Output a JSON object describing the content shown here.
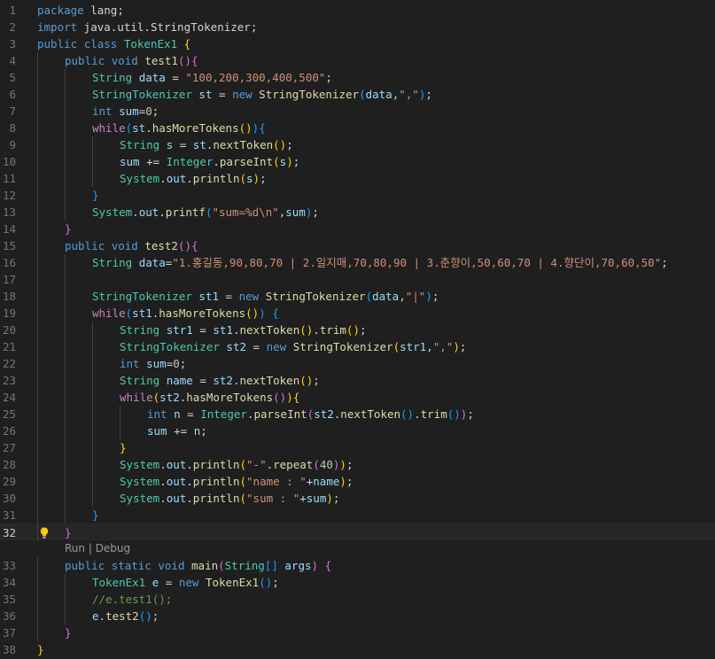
{
  "editor": {
    "colors": {
      "background": "#1f1f1f",
      "activeLine": "#262626",
      "lineNumber": "#6e7681",
      "lightbulb": "#ffcc00"
    },
    "codelens": {
      "run": "Run",
      "separator": " | ",
      "debug": "Debug"
    },
    "lines": [
      {
        "n": "1",
        "tokens": [
          [
            "kw",
            "package"
          ],
          [
            "pl",
            " lang;"
          ]
        ]
      },
      {
        "n": "2",
        "tokens": [
          [
            "kw",
            "import"
          ],
          [
            "pl",
            " java.util.StringTokenizer;"
          ]
        ]
      },
      {
        "n": "3",
        "tokens": [
          [
            "kw",
            "public"
          ],
          [
            "pl",
            " "
          ],
          [
            "kw",
            "class"
          ],
          [
            "pl",
            " "
          ],
          [
            "ty",
            "TokenEx1"
          ],
          [
            "pl",
            " "
          ],
          [
            "p1",
            "{"
          ]
        ]
      },
      {
        "n": "4",
        "indent": 1,
        "tokens": [
          [
            "kw",
            "public"
          ],
          [
            "pl",
            " "
          ],
          [
            "kw",
            "void"
          ],
          [
            "pl",
            " "
          ],
          [
            "fn",
            "test1"
          ],
          [
            "p2",
            "()"
          ],
          [
            "p2",
            "{"
          ]
        ]
      },
      {
        "n": "5",
        "indent": 2,
        "tokens": [
          [
            "ty",
            "String"
          ],
          [
            "pl",
            " "
          ],
          [
            "var",
            "data"
          ],
          [
            "pl",
            " = "
          ],
          [
            "str",
            "\"100,200,300,400,500\""
          ],
          [
            "pl",
            ";"
          ]
        ]
      },
      {
        "n": "6",
        "indent": 2,
        "tokens": [
          [
            "ty",
            "StringTokenizer"
          ],
          [
            "pl",
            " "
          ],
          [
            "var",
            "st"
          ],
          [
            "pl",
            " = "
          ],
          [
            "kw",
            "new"
          ],
          [
            "pl",
            " "
          ],
          [
            "fn",
            "StringTokenizer"
          ],
          [
            "p3",
            "("
          ],
          [
            "var",
            "data"
          ],
          [
            "pl",
            ","
          ],
          [
            "str",
            "\",\""
          ],
          [
            "p3",
            ")"
          ],
          [
            "pl",
            ";"
          ]
        ]
      },
      {
        "n": "7",
        "indent": 2,
        "tokens": [
          [
            "kw",
            "int"
          ],
          [
            "pl",
            " "
          ],
          [
            "var",
            "sum"
          ],
          [
            "pl",
            "="
          ],
          [
            "num",
            "0"
          ],
          [
            "pl",
            ";"
          ]
        ]
      },
      {
        "n": "8",
        "indent": 2,
        "tokens": [
          [
            "ctl",
            "while"
          ],
          [
            "p3",
            "("
          ],
          [
            "var",
            "st"
          ],
          [
            "pl",
            "."
          ],
          [
            "fn",
            "hasMoreTokens"
          ],
          [
            "p1",
            "()"
          ],
          [
            "p3",
            ")"
          ],
          [
            "p3",
            "{"
          ]
        ]
      },
      {
        "n": "9",
        "indent": 3,
        "tokens": [
          [
            "ty",
            "String"
          ],
          [
            "pl",
            " "
          ],
          [
            "var",
            "s"
          ],
          [
            "pl",
            " = "
          ],
          [
            "var",
            "st"
          ],
          [
            "pl",
            "."
          ],
          [
            "fn",
            "nextToken"
          ],
          [
            "p1",
            "()"
          ],
          [
            "pl",
            ";"
          ]
        ]
      },
      {
        "n": "10",
        "indent": 3,
        "tokens": [
          [
            "var",
            "sum"
          ],
          [
            "pl",
            " += "
          ],
          [
            "ty",
            "Integer"
          ],
          [
            "pl",
            "."
          ],
          [
            "fn",
            "parseInt"
          ],
          [
            "p1",
            "("
          ],
          [
            "var",
            "s"
          ],
          [
            "p1",
            ")"
          ],
          [
            "pl",
            ";"
          ]
        ]
      },
      {
        "n": "11",
        "indent": 3,
        "tokens": [
          [
            "ty",
            "System"
          ],
          [
            "pl",
            "."
          ],
          [
            "var",
            "out"
          ],
          [
            "pl",
            "."
          ],
          [
            "fn",
            "println"
          ],
          [
            "p1",
            "("
          ],
          [
            "var",
            "s"
          ],
          [
            "p1",
            ")"
          ],
          [
            "pl",
            ";"
          ]
        ]
      },
      {
        "n": "12",
        "indent": 2,
        "tokens": [
          [
            "p3",
            "}"
          ]
        ]
      },
      {
        "n": "13",
        "indent": 2,
        "tokens": [
          [
            "ty",
            "System"
          ],
          [
            "pl",
            "."
          ],
          [
            "var",
            "out"
          ],
          [
            "pl",
            "."
          ],
          [
            "fn",
            "printf"
          ],
          [
            "p3",
            "("
          ],
          [
            "str",
            "\"sum=%d\\n\""
          ],
          [
            "pl",
            ","
          ],
          [
            "var",
            "sum"
          ],
          [
            "p3",
            ")"
          ],
          [
            "pl",
            ";"
          ]
        ]
      },
      {
        "n": "14",
        "indent": 1,
        "tokens": [
          [
            "p2",
            "}"
          ]
        ]
      },
      {
        "n": "15",
        "indent": 1,
        "tokens": [
          [
            "kw",
            "public"
          ],
          [
            "pl",
            " "
          ],
          [
            "kw",
            "void"
          ],
          [
            "pl",
            " "
          ],
          [
            "fn",
            "test2"
          ],
          [
            "p2",
            "()"
          ],
          [
            "p2",
            "{"
          ]
        ]
      },
      {
        "n": "16",
        "indent": 2,
        "tokens": [
          [
            "ty",
            "String"
          ],
          [
            "pl",
            " "
          ],
          [
            "var",
            "data"
          ],
          [
            "pl",
            "="
          ],
          [
            "str",
            "\"1.홍길동,90,80,70 | 2.일지매,70,80,90 | 3.춘향이,50,60,70 | 4.향단이,70,60,50\""
          ],
          [
            "pl",
            ";"
          ]
        ]
      },
      {
        "n": "17",
        "indent": 2,
        "tokens": []
      },
      {
        "n": "18",
        "indent": 2,
        "tokens": [
          [
            "ty",
            "StringTokenizer"
          ],
          [
            "pl",
            " "
          ],
          [
            "var",
            "st1"
          ],
          [
            "pl",
            " = "
          ],
          [
            "kw",
            "new"
          ],
          [
            "pl",
            " "
          ],
          [
            "fn",
            "StringTokenizer"
          ],
          [
            "p3",
            "("
          ],
          [
            "var",
            "data"
          ],
          [
            "pl",
            ","
          ],
          [
            "str",
            "\"|\""
          ],
          [
            "p3",
            ")"
          ],
          [
            "pl",
            ";"
          ]
        ]
      },
      {
        "n": "19",
        "indent": 2,
        "tokens": [
          [
            "ctl",
            "while"
          ],
          [
            "p3",
            "("
          ],
          [
            "var",
            "st1"
          ],
          [
            "pl",
            "."
          ],
          [
            "fn",
            "hasMoreTokens"
          ],
          [
            "p1",
            "()"
          ],
          [
            "p3",
            ")"
          ],
          [
            "pl",
            " "
          ],
          [
            "p3",
            "{"
          ]
        ]
      },
      {
        "n": "20",
        "indent": 3,
        "tokens": [
          [
            "ty",
            "String"
          ],
          [
            "pl",
            " "
          ],
          [
            "var",
            "str1"
          ],
          [
            "pl",
            " = "
          ],
          [
            "var",
            "st1"
          ],
          [
            "pl",
            "."
          ],
          [
            "fn",
            "nextToken"
          ],
          [
            "p1",
            "()"
          ],
          [
            "pl",
            "."
          ],
          [
            "fn",
            "trim"
          ],
          [
            "p1",
            "()"
          ],
          [
            "pl",
            ";"
          ]
        ]
      },
      {
        "n": "21",
        "indent": 3,
        "tokens": [
          [
            "ty",
            "StringTokenizer"
          ],
          [
            "pl",
            " "
          ],
          [
            "var",
            "st2"
          ],
          [
            "pl",
            " = "
          ],
          [
            "kw",
            "new"
          ],
          [
            "pl",
            " "
          ],
          [
            "fn",
            "StringTokenizer"
          ],
          [
            "p1",
            "("
          ],
          [
            "var",
            "str1"
          ],
          [
            "pl",
            ","
          ],
          [
            "str",
            "\",\""
          ],
          [
            "p1",
            ")"
          ],
          [
            "pl",
            ";"
          ]
        ]
      },
      {
        "n": "22",
        "indent": 3,
        "tokens": [
          [
            "kw",
            "int"
          ],
          [
            "pl",
            " "
          ],
          [
            "var",
            "sum"
          ],
          [
            "pl",
            "="
          ],
          [
            "num",
            "0"
          ],
          [
            "pl",
            ";"
          ]
        ]
      },
      {
        "n": "23",
        "indent": 3,
        "tokens": [
          [
            "ty",
            "String"
          ],
          [
            "pl",
            " "
          ],
          [
            "var",
            "name"
          ],
          [
            "pl",
            " = "
          ],
          [
            "var",
            "st2"
          ],
          [
            "pl",
            "."
          ],
          [
            "fn",
            "nextToken"
          ],
          [
            "p1",
            "()"
          ],
          [
            "pl",
            ";"
          ]
        ]
      },
      {
        "n": "24",
        "indent": 3,
        "tokens": [
          [
            "ctl",
            "while"
          ],
          [
            "p1",
            "("
          ],
          [
            "var",
            "st2"
          ],
          [
            "pl",
            "."
          ],
          [
            "fn",
            "hasMoreTokens"
          ],
          [
            "p2",
            "()"
          ],
          [
            "p1",
            ")"
          ],
          [
            "p1",
            "{"
          ]
        ]
      },
      {
        "n": "25",
        "indent": 4,
        "tokens": [
          [
            "kw",
            "int"
          ],
          [
            "pl",
            " "
          ],
          [
            "var",
            "n"
          ],
          [
            "pl",
            " = "
          ],
          [
            "ty",
            "Integer"
          ],
          [
            "pl",
            "."
          ],
          [
            "fn",
            "parseInt"
          ],
          [
            "p2",
            "("
          ],
          [
            "var",
            "st2"
          ],
          [
            "pl",
            "."
          ],
          [
            "fn",
            "nextToken"
          ],
          [
            "p3",
            "()"
          ],
          [
            "pl",
            "."
          ],
          [
            "fn",
            "trim"
          ],
          [
            "p3",
            "()"
          ],
          [
            "p2",
            ")"
          ],
          [
            "pl",
            ";"
          ]
        ]
      },
      {
        "n": "26",
        "indent": 4,
        "tokens": [
          [
            "var",
            "sum"
          ],
          [
            "pl",
            " += "
          ],
          [
            "var",
            "n"
          ],
          [
            "pl",
            ";"
          ]
        ]
      },
      {
        "n": "27",
        "indent": 3,
        "tokens": [
          [
            "p1",
            "}"
          ]
        ]
      },
      {
        "n": "28",
        "indent": 3,
        "tokens": [
          [
            "ty",
            "System"
          ],
          [
            "pl",
            "."
          ],
          [
            "var",
            "out"
          ],
          [
            "pl",
            "."
          ],
          [
            "fn",
            "println"
          ],
          [
            "p1",
            "("
          ],
          [
            "str",
            "\"-\""
          ],
          [
            "pl",
            "."
          ],
          [
            "fn",
            "repeat"
          ],
          [
            "p2",
            "("
          ],
          [
            "num",
            "40"
          ],
          [
            "p2",
            ")"
          ],
          [
            "p1",
            ")"
          ],
          [
            "pl",
            ";"
          ]
        ]
      },
      {
        "n": "29",
        "indent": 3,
        "tokens": [
          [
            "ty",
            "System"
          ],
          [
            "pl",
            "."
          ],
          [
            "var",
            "out"
          ],
          [
            "pl",
            "."
          ],
          [
            "fn",
            "println"
          ],
          [
            "p1",
            "("
          ],
          [
            "str",
            "\"name : \""
          ],
          [
            "pl",
            "+"
          ],
          [
            "var",
            "name"
          ],
          [
            "p1",
            ")"
          ],
          [
            "pl",
            ";"
          ]
        ]
      },
      {
        "n": "30",
        "indent": 3,
        "tokens": [
          [
            "ty",
            "System"
          ],
          [
            "pl",
            "."
          ],
          [
            "var",
            "out"
          ],
          [
            "pl",
            "."
          ],
          [
            "fn",
            "println"
          ],
          [
            "p1",
            "("
          ],
          [
            "str",
            "\"sum : \""
          ],
          [
            "pl",
            "+"
          ],
          [
            "var",
            "sum"
          ],
          [
            "p1",
            ")"
          ],
          [
            "pl",
            ";"
          ]
        ]
      },
      {
        "n": "31",
        "indent": 2,
        "tokens": [
          [
            "p3",
            "}"
          ]
        ]
      },
      {
        "n": "32",
        "indent": 1,
        "active": true,
        "bulb": true,
        "tokens": [
          [
            "p2",
            "}"
          ]
        ]
      },
      {
        "n": "33",
        "indent": 1,
        "lens": true,
        "tokens": [
          [
            "kw",
            "public"
          ],
          [
            "pl",
            " "
          ],
          [
            "kw",
            "static"
          ],
          [
            "pl",
            " "
          ],
          [
            "kw",
            "void"
          ],
          [
            "pl",
            " "
          ],
          [
            "fn",
            "main"
          ],
          [
            "p2",
            "("
          ],
          [
            "ty",
            "String"
          ],
          [
            "p3",
            "[]"
          ],
          [
            "pl",
            " "
          ],
          [
            "var",
            "args"
          ],
          [
            "p2",
            ")"
          ],
          [
            "pl",
            " "
          ],
          [
            "p2",
            "{"
          ]
        ]
      },
      {
        "n": "34",
        "indent": 2,
        "tokens": [
          [
            "ty",
            "TokenEx1"
          ],
          [
            "pl",
            " "
          ],
          [
            "var",
            "e"
          ],
          [
            "pl",
            " = "
          ],
          [
            "kw",
            "new"
          ],
          [
            "pl",
            " "
          ],
          [
            "fn",
            "TokenEx1"
          ],
          [
            "p3",
            "()"
          ],
          [
            "pl",
            ";"
          ]
        ]
      },
      {
        "n": "35",
        "indent": 2,
        "tokens": [
          [
            "com",
            "//e.test1();"
          ]
        ]
      },
      {
        "n": "36",
        "indent": 2,
        "tokens": [
          [
            "var",
            "e"
          ],
          [
            "pl",
            "."
          ],
          [
            "fn",
            "test2"
          ],
          [
            "p3",
            "()"
          ],
          [
            "pl",
            ";"
          ]
        ]
      },
      {
        "n": "37",
        "indent": 1,
        "tokens": [
          [
            "p2",
            "}"
          ]
        ]
      },
      {
        "n": "38",
        "indent": 0,
        "tokens": [
          [
            "p1",
            "}"
          ]
        ]
      }
    ]
  }
}
